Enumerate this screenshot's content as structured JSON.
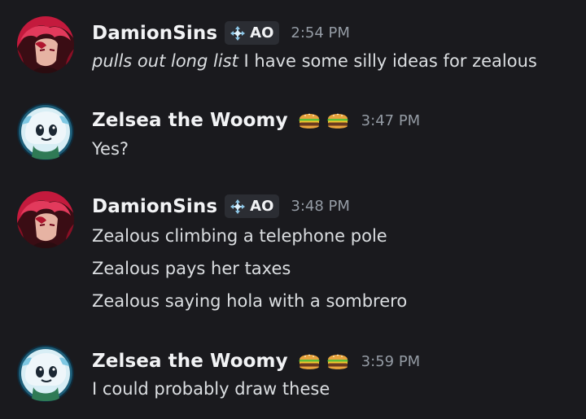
{
  "messages": [
    {
      "author": "DamionSins",
      "tag": "AO",
      "avatar": "red-haired-anime-avatar",
      "timestamp": "2:54 PM",
      "lines": [
        {
          "italic_prefix": "pulls out long list",
          "text": " I have some silly ideas for zealous"
        }
      ]
    },
    {
      "author": "Zelsea the Woomy",
      "emoji": [
        "hamburger-emoji",
        "hamburger-emoji"
      ],
      "avatar": "squid-character-avatar",
      "timestamp": "3:47 PM",
      "lines": [
        {
          "text": "Yes?"
        }
      ]
    },
    {
      "author": "DamionSins",
      "tag": "AO",
      "avatar": "red-haired-anime-avatar",
      "timestamp": "3:48 PM",
      "lines": [
        {
          "text": "Zealous climbing a telephone pole"
        },
        {
          "text": "Zealous pays her taxes"
        },
        {
          "text": "Zealous saying hola with a sombrero"
        }
      ]
    },
    {
      "author": "Zelsea the Woomy",
      "emoji": [
        "hamburger-emoji",
        "hamburger-emoji"
      ],
      "avatar": "squid-character-avatar",
      "timestamp": "3:59 PM",
      "lines": [
        {
          "text": "I could probably draw these"
        }
      ]
    }
  ],
  "colors": {
    "background": "#1a1a1e",
    "username": "#f2f3f5",
    "message_text": "#dbdee1",
    "timestamp": "#949ba4",
    "tag_background": "#2b2d33"
  }
}
